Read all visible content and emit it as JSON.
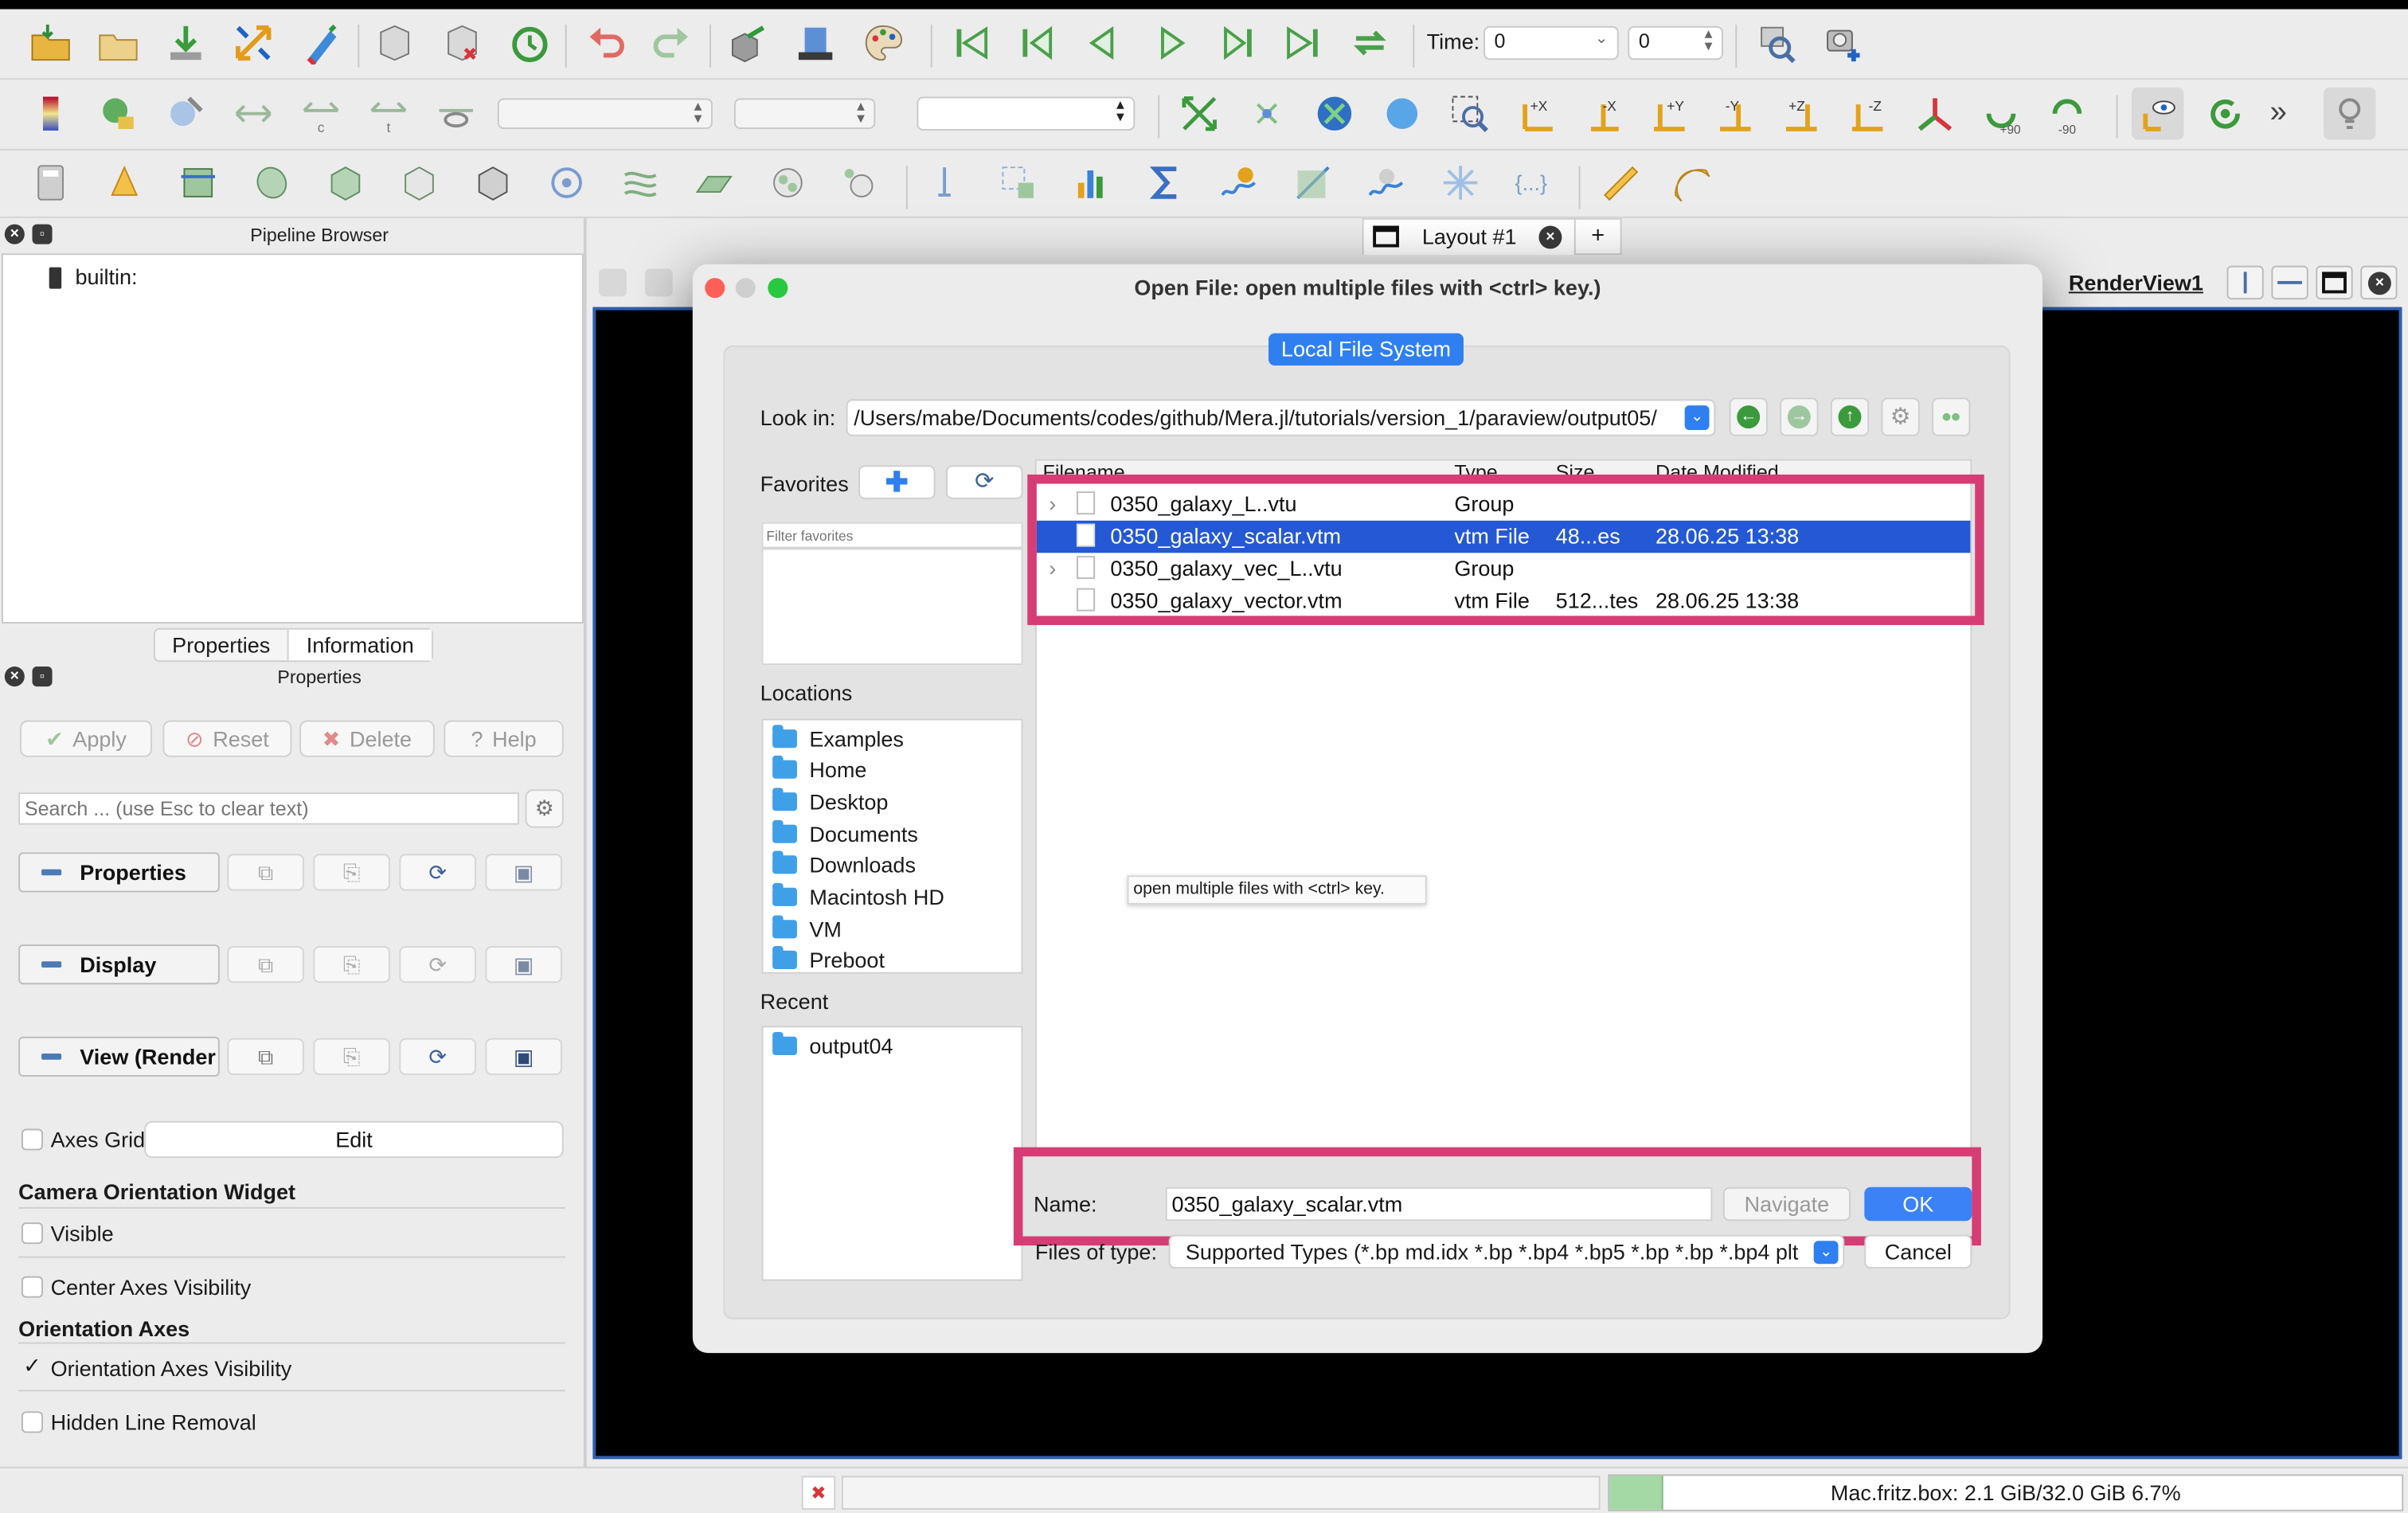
{
  "toolbar": {
    "time_label": "Time:",
    "time_value": "0",
    "time_step": "0",
    "rotate_plus": "+90",
    "rotate_minus": "-90",
    "axis_buttons": [
      "+X",
      "-X",
      "+Y",
      "-Y",
      "+Z",
      "-Z"
    ],
    "overflow": "»"
  },
  "pipeline": {
    "title": "Pipeline Browser",
    "root_item": "builtin:"
  },
  "tabs": {
    "properties": "Properties",
    "information": "Information"
  },
  "properties_panel": {
    "title": "Properties",
    "apply": "Apply",
    "reset": "Reset",
    "delete": "Delete",
    "help": "Help",
    "search_placeholder": "Search ... (use Esc to clear text)",
    "sections": [
      "Properties",
      "Display",
      "View (Render View)"
    ],
    "axes_grid": "Axes Grid",
    "edit": "Edit",
    "camera_widget_heading": "Camera Orientation Widget",
    "visible": "Visible",
    "center_axes_visibility": "Center Axes Visibility",
    "orientation_axes_heading": "Orientation Axes",
    "orientation_axes_visibility": "Orientation Axes Visibility",
    "orientation_axes_checked": true,
    "hidden_line_removal": "Hidden Line Removal"
  },
  "layout": {
    "tab": "Layout #1",
    "add": "+",
    "view_name": "RenderView1"
  },
  "dialog": {
    "title": "Open File:  open multiple files with <ctrl> key.)",
    "mode_tab": "Local File System",
    "look_in_label": "Look in:",
    "look_in_path": "/Users/mabe/Documents/codes/github/Mera.jl/tutorials/version_1/paraview/output05/",
    "favorites_label": "Favorites",
    "filter_placeholder": "Filter favorites",
    "locations_label": "Locations",
    "locations": [
      "Examples",
      "Home",
      "Desktop",
      "Documents",
      "Downloads",
      "Macintosh HD",
      "VM",
      "Preboot"
    ],
    "recent_label": "Recent",
    "recent": [
      "output04"
    ],
    "columns": [
      "Filename",
      "Type",
      "Size",
      "Date Modified"
    ],
    "files": [
      {
        "name": "0350_galaxy_L..vtu",
        "type": "Group",
        "size": "",
        "date": "",
        "expandable": true,
        "selected": false
      },
      {
        "name": "0350_galaxy_scalar.vtm",
        "type": "vtm File",
        "size": "48...es",
        "date": "28.06.25 13:38",
        "expandable": false,
        "selected": true
      },
      {
        "name": "0350_galaxy_vec_L..vtu",
        "type": "Group",
        "size": "",
        "date": "",
        "expandable": true,
        "selected": false
      },
      {
        "name": "0350_galaxy_vector.vtm",
        "type": "vtm File",
        "size": "512...tes",
        "date": "28.06.25 13:38",
        "expandable": false,
        "selected": false
      }
    ],
    "tooltip": "open multiple files with <ctrl> key.",
    "name_label": "Name:",
    "name_value": "0350_galaxy_scalar.vtm",
    "navigate": "Navigate",
    "ok": "OK",
    "files_of_type_label": "Files of type:",
    "files_of_type_value": "Supported Types (*.bp md.idx *.bp *.bp4 *.bp5 *.bp *.bp *.bp4 plt",
    "cancel": "Cancel"
  },
  "status": {
    "memory": "Mac.fritz.box: 2.1 GiB/32.0 GiB 6.7%",
    "memory_fraction": 0.067
  },
  "colors": {
    "highlight": "#d63d74",
    "selection": "#2458d4",
    "accent": "#3b82f6"
  }
}
